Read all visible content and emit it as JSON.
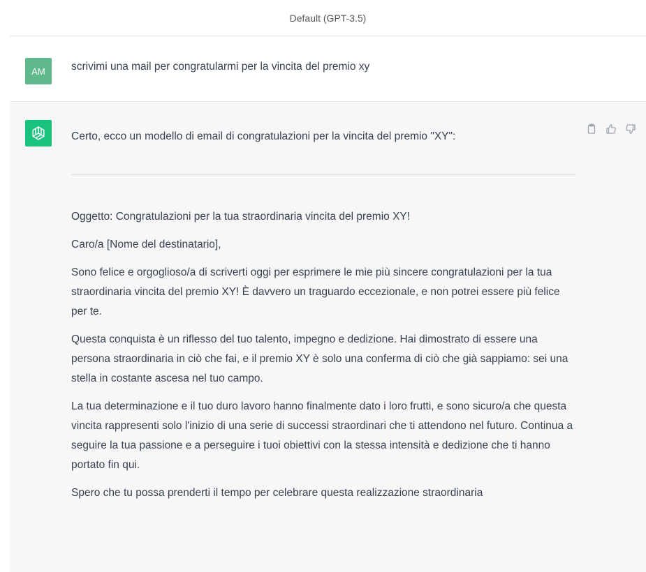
{
  "header": {
    "model_label": "Default (GPT-3.5)"
  },
  "user": {
    "initials": "AM",
    "message": "scrivimi una mail per congratularmi per la vincita del premio xy"
  },
  "assistant": {
    "intro": "Certo, ecco un modello di email di congratulazioni per la vincita del premio \"XY\":",
    "paragraphs": [
      "Oggetto: Congratulazioni per la tua straordinaria vincita del premio XY!",
      "Caro/a [Nome del destinatario],",
      "Sono felice e orgoglioso/a di scriverti oggi per esprimere le mie più sincere congratulazioni per la tua straordinaria vincita del premio XY! È davvero un traguardo eccezionale, e non potrei essere più felice per te.",
      "Questa conquista è un riflesso del tuo talento, impegno e dedizione. Hai dimostrato di essere una persona straordinaria in ciò che fai, e il premio XY è solo una conferma di ciò che già sappiamo: sei una stella in costante ascesa nel tuo campo.",
      "La tua determinazione e il tuo duro lavoro hanno finalmente dato i loro frutti, e sono sicuro/a che questa vincita rappresenti solo l'inizio di una serie di successi straordinari che ti attendono nel futuro. Continua a seguire la tua passione e a perseguire i tuoi obiettivi con la stessa intensità e dedizione che ti hanno portato fin qui.",
      "Spero che tu possa prenderti il tempo per celebrare questa realizzazione straordinaria"
    ]
  },
  "icons": {
    "copy": "clipboard-icon",
    "like": "thumbs-up-icon",
    "dislike": "thumbs-down-icon",
    "bot": "openai-logo-icon"
  },
  "colors": {
    "user_avatar": "#5fb88a",
    "bot_avatar": "#19c37d",
    "assistant_bg": "#f7f7f8"
  }
}
